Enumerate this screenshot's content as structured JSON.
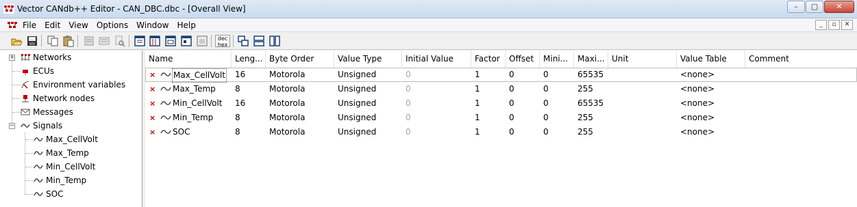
{
  "window": {
    "title": "Vector CANdb++ Editor - CAN_DBC.dbc - [Overall View]",
    "buttons": {
      "minimize": "–",
      "maximize": "▢",
      "close": "✕"
    }
  },
  "menu": {
    "items": [
      "File",
      "Edit",
      "View",
      "Options",
      "Window",
      "Help"
    ],
    "mdi_buttons": {
      "minimize": "_",
      "restore": "▫",
      "close": "✕"
    }
  },
  "toolbar": {
    "icons": [
      "open-icon",
      "save-icon",
      "copy-icon",
      "paste-icon",
      "properties-icon",
      "list-icon",
      "find-icon",
      "view-1-icon",
      "view-2-icon",
      "view-3-icon",
      "view-4-icon",
      "view-5-icon",
      "dec-hex-icon",
      "cascade-icon",
      "tile-horizontal-icon",
      "tile-vertical-icon"
    ],
    "dec_hex_top": "dec",
    "dec_hex_bottom": "hex"
  },
  "tree": {
    "items": [
      {
        "label": "Networks",
        "icon": "network-icon"
      },
      {
        "label": "ECUs",
        "icon": "ecu-icon"
      },
      {
        "label": "Environment variables",
        "icon": "env-var-icon"
      },
      {
        "label": "Network nodes",
        "icon": "network-node-icon"
      },
      {
        "label": "Messages",
        "icon": "message-icon"
      },
      {
        "label": "Signals",
        "icon": "signal-icon"
      }
    ],
    "signals": [
      "Max_CellVolt",
      "Max_Temp",
      "Min_CellVolt",
      "Min_Temp",
      "SOC"
    ]
  },
  "table": {
    "columns": [
      "Name",
      "Leng...",
      "Byte Order",
      "Value Type",
      "Initial Value",
      "Factor",
      "Offset",
      "Mini...",
      "Maxi...",
      "Unit",
      "Value Table",
      "Comment"
    ],
    "rows": [
      {
        "name": "Max_CellVolt",
        "length": "16",
        "byte_order": "Motorola",
        "value_type": "Unsigned",
        "initial": "0",
        "factor": "1",
        "offset": "0",
        "min": "0",
        "max": "65535",
        "unit": "",
        "value_table": "<none>",
        "comment": ""
      },
      {
        "name": "Max_Temp",
        "length": "8",
        "byte_order": "Motorola",
        "value_type": "Unsigned",
        "initial": "0",
        "factor": "1",
        "offset": "0",
        "min": "0",
        "max": "255",
        "unit": "",
        "value_table": "<none>",
        "comment": ""
      },
      {
        "name": "Min_CellVolt",
        "length": "16",
        "byte_order": "Motorola",
        "value_type": "Unsigned",
        "initial": "0",
        "factor": "1",
        "offset": "0",
        "min": "0",
        "max": "65535",
        "unit": "",
        "value_table": "<none>",
        "comment": ""
      },
      {
        "name": "Min_Temp",
        "length": "8",
        "byte_order": "Motorola",
        "value_type": "Unsigned",
        "initial": "0",
        "factor": "1",
        "offset": "0",
        "min": "0",
        "max": "255",
        "unit": "",
        "value_table": "<none>",
        "comment": ""
      },
      {
        "name": "SOC",
        "length": "8",
        "byte_order": "Motorola",
        "value_type": "Unsigned",
        "initial": "0",
        "factor": "1",
        "offset": "0",
        "min": "0",
        "max": "255",
        "unit": "",
        "value_table": "<none>",
        "comment": ""
      }
    ],
    "row_marker": "×"
  },
  "colors": {
    "accent": "#c00000",
    "selection_outline": "#777777",
    "disabled_text": "#a6a6a6"
  }
}
